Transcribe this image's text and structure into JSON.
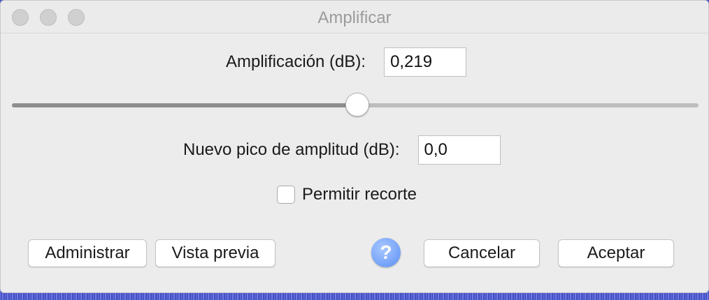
{
  "window": {
    "title": "Amplificar"
  },
  "amplification": {
    "label": "Amplificación (dB):",
    "value": "0,219"
  },
  "slider": {
    "level_fraction": 0.503
  },
  "peak": {
    "label": "Nuevo pico de amplitud (dB):",
    "value": "0,0"
  },
  "clipping": {
    "label": "Permitir recorte",
    "checked": false
  },
  "buttons": {
    "manage": "Administrar",
    "preview": "Vista previa",
    "help": "?",
    "cancel": "Cancelar",
    "ok": "Aceptar"
  },
  "colors": {
    "help_accent": "#5b8ff5",
    "background_waveform": "#4a55c8"
  }
}
